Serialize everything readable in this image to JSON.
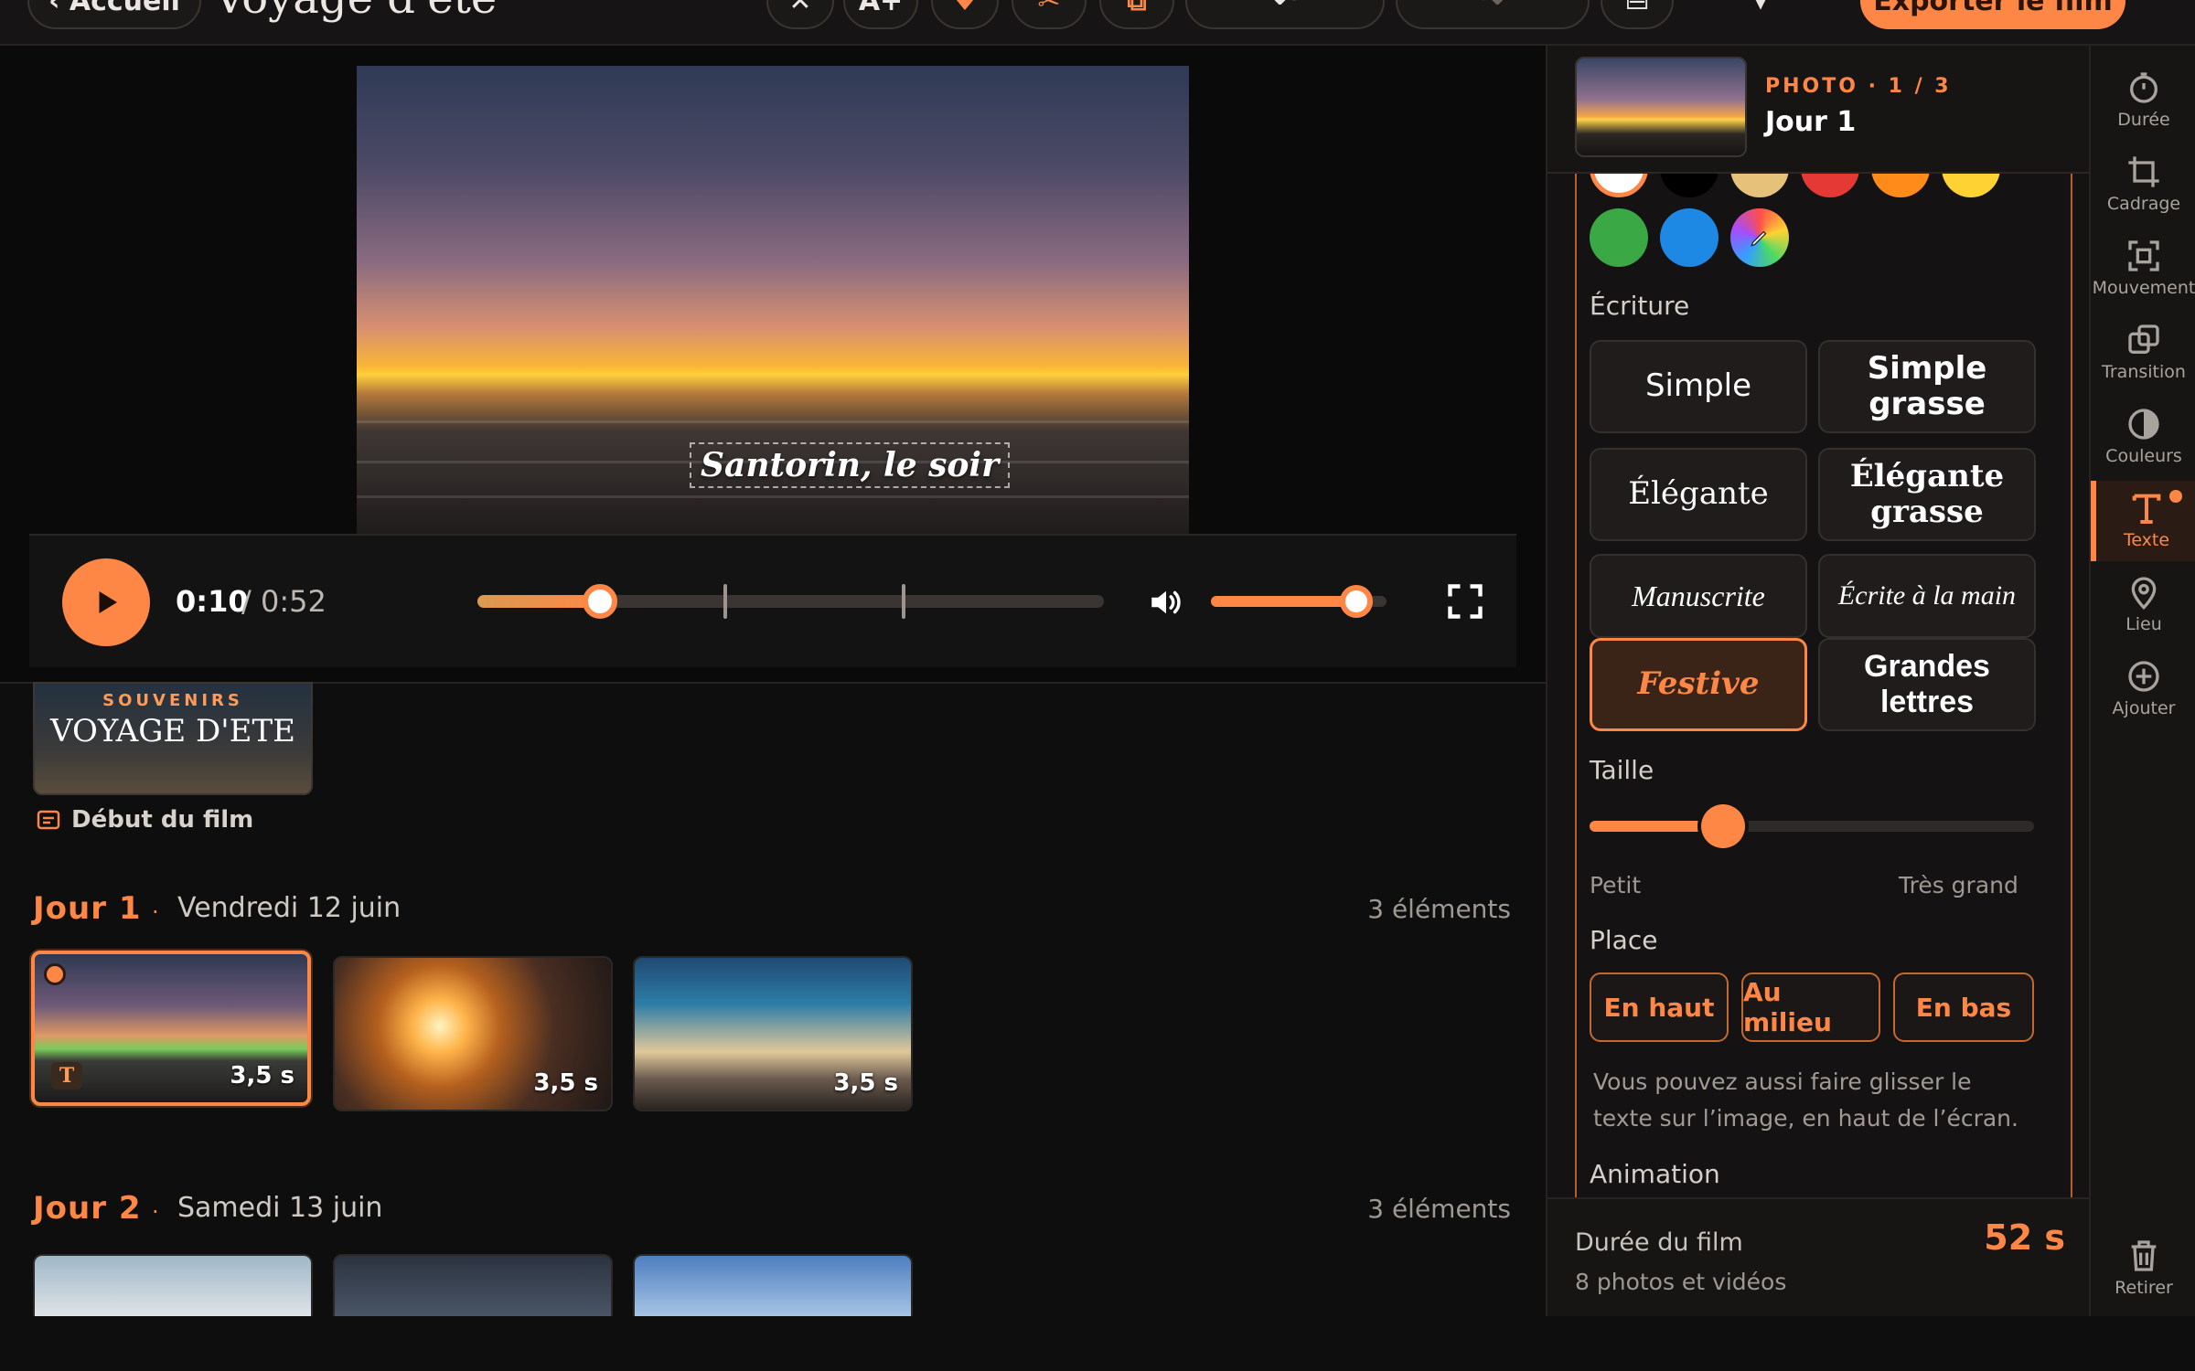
{
  "header": {
    "back_label": "‹ Accueil",
    "project_title": "Voyage d'été",
    "export_label": "Exporter le film"
  },
  "player": {
    "caption": "Santorin, le soir",
    "time_current": "0:10",
    "time_total": "/ 0:52",
    "progress_fraction": 0.195,
    "volume_fraction": 0.83,
    "markers_fraction": [
      0.392,
      0.678
    ]
  },
  "intro": {
    "subtitle": "SOUVENIRS",
    "title": "VOYAGE D'ETE",
    "label": "Début du film"
  },
  "days": [
    {
      "name": "Jour 1",
      "sep": "·",
      "date": "Vendredi 12 juin",
      "count": "3 éléments",
      "items": [
        {
          "duration": "3,5 s"
        },
        {
          "duration": "3,5 s"
        },
        {
          "duration": "3,5 s"
        }
      ]
    },
    {
      "name": "Jour 2",
      "sep": "·",
      "date": "Samedi 13 juin",
      "count": "3 éléments"
    }
  ],
  "selected_badge": "T",
  "panel": {
    "photo_index": "PHOTO · 1 / 3",
    "photo_title": "Jour 1",
    "colors": [
      "#ffffff",
      "#000000",
      "#e6c17a",
      "#e53935",
      "#ff8c1a",
      "#ffd233",
      "#3aa845",
      "#1e88e5"
    ],
    "writing_label": "Écriture",
    "fonts": [
      "Simple",
      "Simple grasse",
      "Élégante",
      "Élégante grasse",
      "Manuscrite",
      "Écrite à la main",
      "Festive",
      "Grandes lettres"
    ],
    "active_font": "Festive",
    "size_label": "Taille",
    "size_min": "Petit",
    "size_max": "Très grand",
    "size_fraction": 0.3,
    "place_label": "Place",
    "places": [
      "En haut",
      "Au milieu",
      "En bas"
    ],
    "hint": "Vous pouvez aussi faire glisser le texte sur l’image, en haut de l’écran.",
    "animation_label": "Animation"
  },
  "footer": {
    "duration_label": "Durée du film",
    "duration_value": "52 s",
    "media_count": "8 photos et vidéos"
  },
  "rail": [
    {
      "label": "Durée",
      "icon": "timer-icon"
    },
    {
      "label": "Cadrage",
      "icon": "crop-icon"
    },
    {
      "label": "Mouvement",
      "icon": "focus-icon"
    },
    {
      "label": "Transition",
      "icon": "layers-icon"
    },
    {
      "label": "Couleurs",
      "icon": "contrast-icon"
    },
    {
      "label": "Texte",
      "icon": "text-icon"
    },
    {
      "label": "Lieu",
      "icon": "map-pin-icon"
    },
    {
      "label": "Ajouter",
      "icon": "plus-circle-icon"
    },
    {
      "label": "Retirer",
      "icon": "trash-icon"
    }
  ]
}
